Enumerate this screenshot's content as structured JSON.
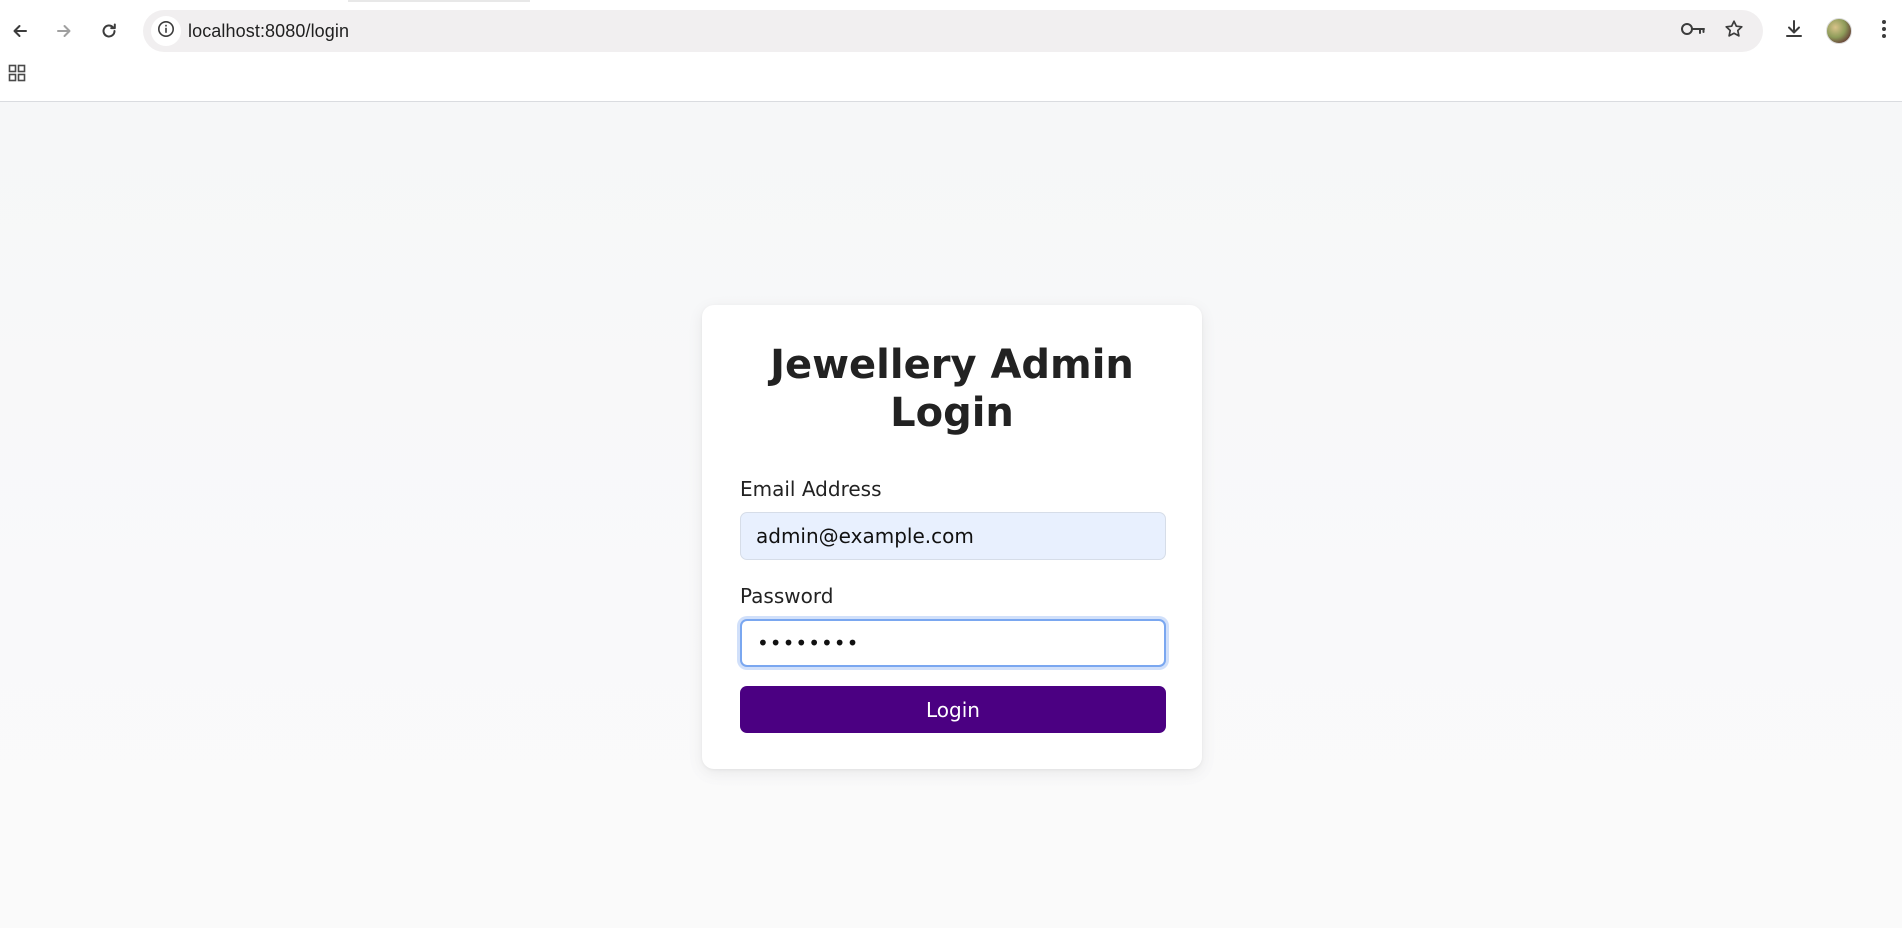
{
  "browser": {
    "url": "localhost:8080/login",
    "icons": {
      "back": "back-arrow-icon",
      "forward": "forward-arrow-icon",
      "reload": "reload-icon",
      "site_info": "info-icon",
      "password_key": "key-icon",
      "bookmark": "star-icon",
      "download": "download-icon",
      "profile": "avatar",
      "menu": "kebab-menu-icon",
      "apps": "apps-grid-icon"
    }
  },
  "login_card": {
    "title": "Jewellery Admin Login",
    "email_label": "Email Address",
    "email_value": "admin@example.com",
    "password_label": "Password",
    "password_value": "••••••••",
    "submit_label": "Login"
  },
  "colors": {
    "accent": "#4b0082",
    "autofill_bg": "#e8f0fe",
    "focus_ring": "#7aa7f0",
    "page_bg": "#f7f8f9"
  }
}
